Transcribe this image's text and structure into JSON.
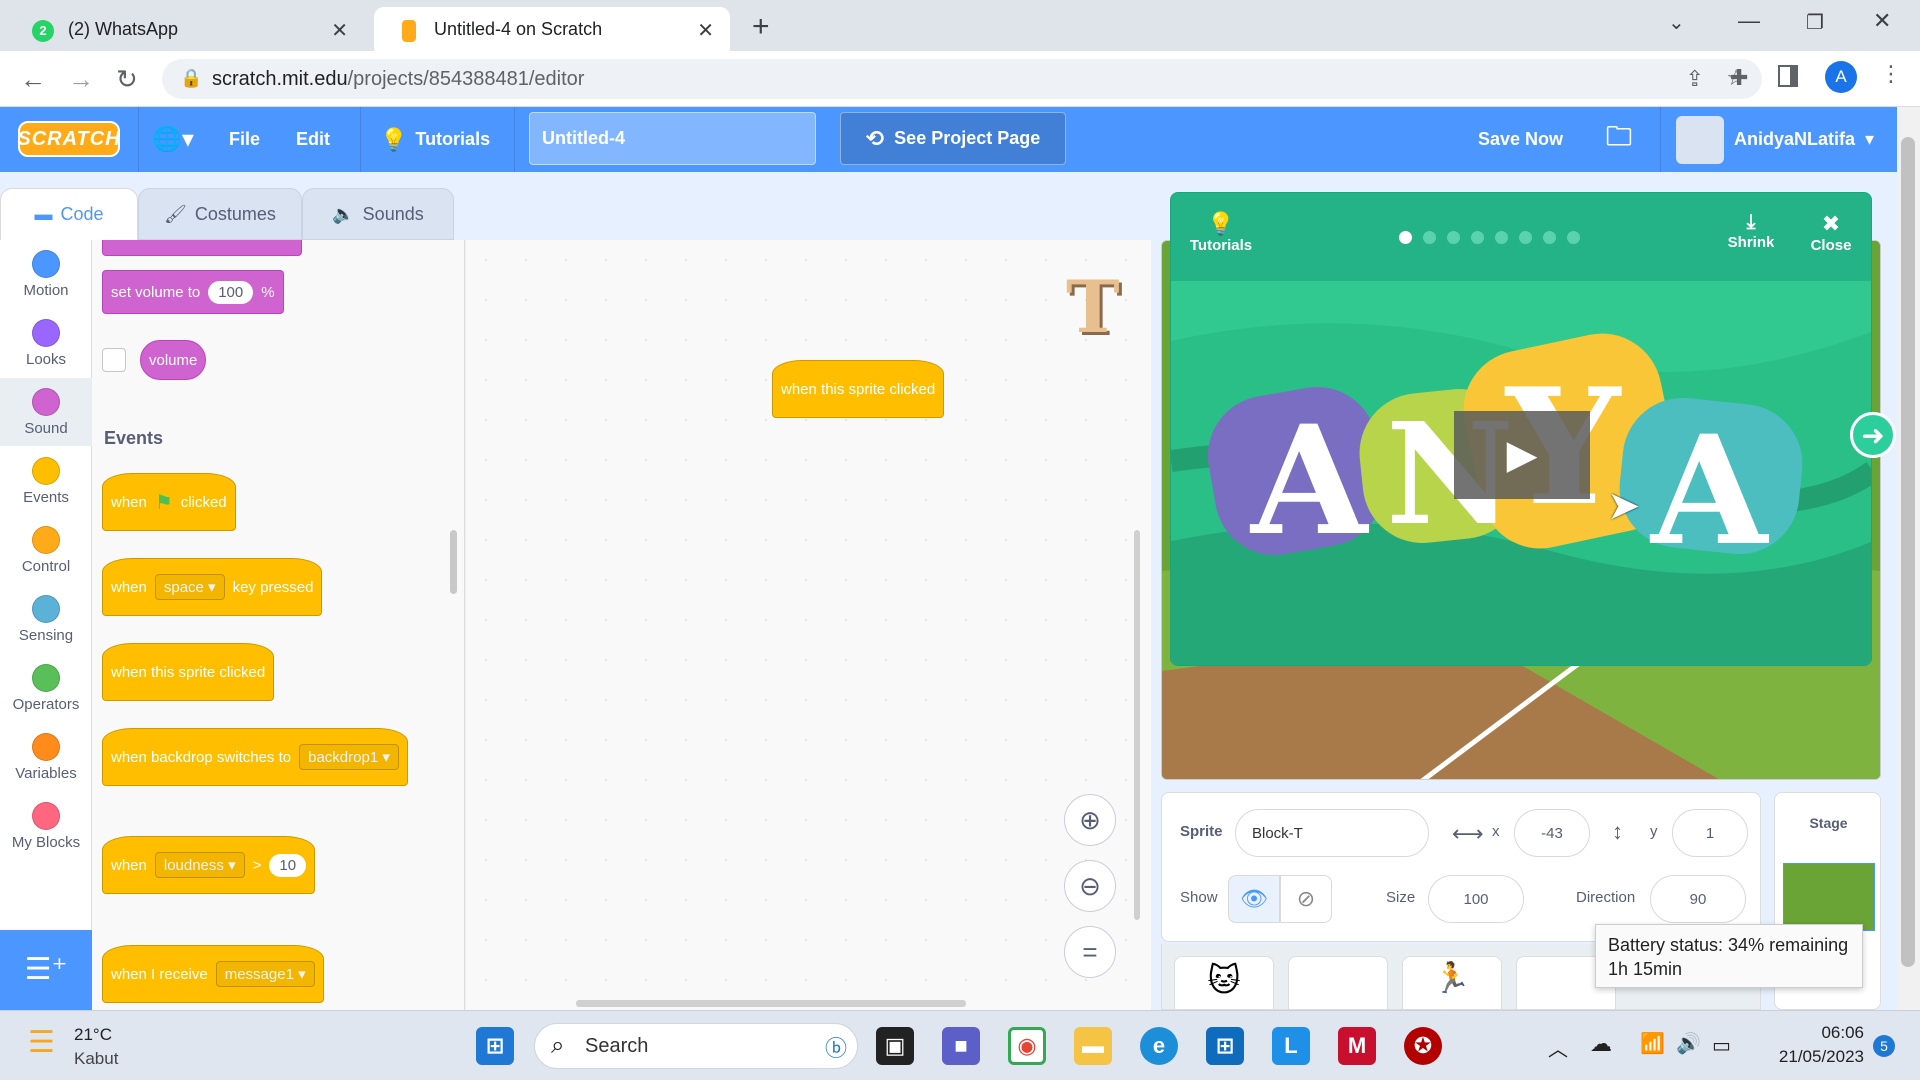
{
  "browser": {
    "tabs": [
      {
        "title": "(2) WhatsApp",
        "badge": "2"
      },
      {
        "title": "Untitled-4 on Scratch"
      }
    ],
    "url_host": "scratch.mit.edu",
    "url_path": "/projects/854388481/editor",
    "profile_initial": "A"
  },
  "menubar": {
    "logo": "SCRATCH",
    "file": "File",
    "edit": "Edit",
    "tutorials": "Tutorials",
    "project_title": "Untitled-4",
    "see_project": "See Project Page",
    "save_now": "Save Now",
    "username": "AnidyaNLatifa"
  },
  "editor_tabs": {
    "code": "Code",
    "costumes": "Costumes",
    "sounds": "Sounds"
  },
  "categories": [
    {
      "label": "Motion",
      "color": "#4c97ff"
    },
    {
      "label": "Looks",
      "color": "#9966ff"
    },
    {
      "label": "Sound",
      "color": "#cf63cf"
    },
    {
      "label": "Events",
      "color": "#ffbf00"
    },
    {
      "label": "Control",
      "color": "#ffab19"
    },
    {
      "label": "Sensing",
      "color": "#5cb1d6"
    },
    {
      "label": "Operators",
      "color": "#59c059"
    },
    {
      "label": "Variables",
      "color": "#ff8c1a"
    },
    {
      "label": "My Blocks",
      "color": "#ff6680"
    }
  ],
  "palette": {
    "set_volume": "set volume to",
    "set_volume_value": "100",
    "percent": "%",
    "volume": "volume",
    "events_heading": "Events",
    "when": "when",
    "clicked": "clicked",
    "space": "space",
    "key_pressed": "key pressed",
    "when_sprite_clicked": "when this sprite clicked",
    "when_backdrop": "when backdrop switches to",
    "backdrop1": "backdrop1",
    "loudness": "loudness",
    "gt": ">",
    "loudness_value": "10",
    "when_i_receive": "when I receive",
    "message1": "message1"
  },
  "script_area": {
    "block": "when this sprite clicked"
  },
  "tutorial_modal": {
    "tutorials_label": "Tutorials",
    "shrink": "Shrink",
    "close": "Close",
    "letters": [
      "A",
      "N",
      "Y",
      "A"
    ]
  },
  "sprite_info": {
    "sprite_label": "Sprite",
    "sprite_name": "Block-T",
    "x_label": "x",
    "x_value": "-43",
    "y_label": "y",
    "y_value": "1",
    "show_label": "Show",
    "size_label": "Size",
    "size_value": "100",
    "direction_label": "Direction",
    "direction_value": "90",
    "stage_label": "Stage"
  },
  "tooltip": {
    "line1": "Battery status: 34% remaining",
    "line2": "1h 15min"
  },
  "taskbar": {
    "temp": "21°C",
    "weather": "Kabut",
    "search": "Search",
    "time": "06:06",
    "date": "21/05/2023",
    "notif_count": "5"
  }
}
